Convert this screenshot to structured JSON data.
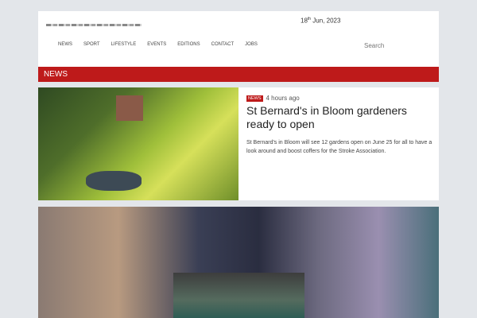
{
  "header": {
    "date_day": "18",
    "date_suffix": "th",
    "date_rest": " Jun, 2023",
    "search_placeholder": "Search",
    "nav": [
      "NEWS",
      "SPORT",
      "LIFESTYLE",
      "EVENTS",
      "EDITIONS",
      "CONTACT",
      "JOBS"
    ]
  },
  "section": {
    "title": "NEWS"
  },
  "article": {
    "badge": "NEWS",
    "time": "4 hours ago",
    "title": "St Bernard's in Bloom gardeners ready to open",
    "summary": "St Bernard's in Bloom will see 12 gardens open on June 25 for all to have a look around and boost coffers for the Stroke Association."
  }
}
